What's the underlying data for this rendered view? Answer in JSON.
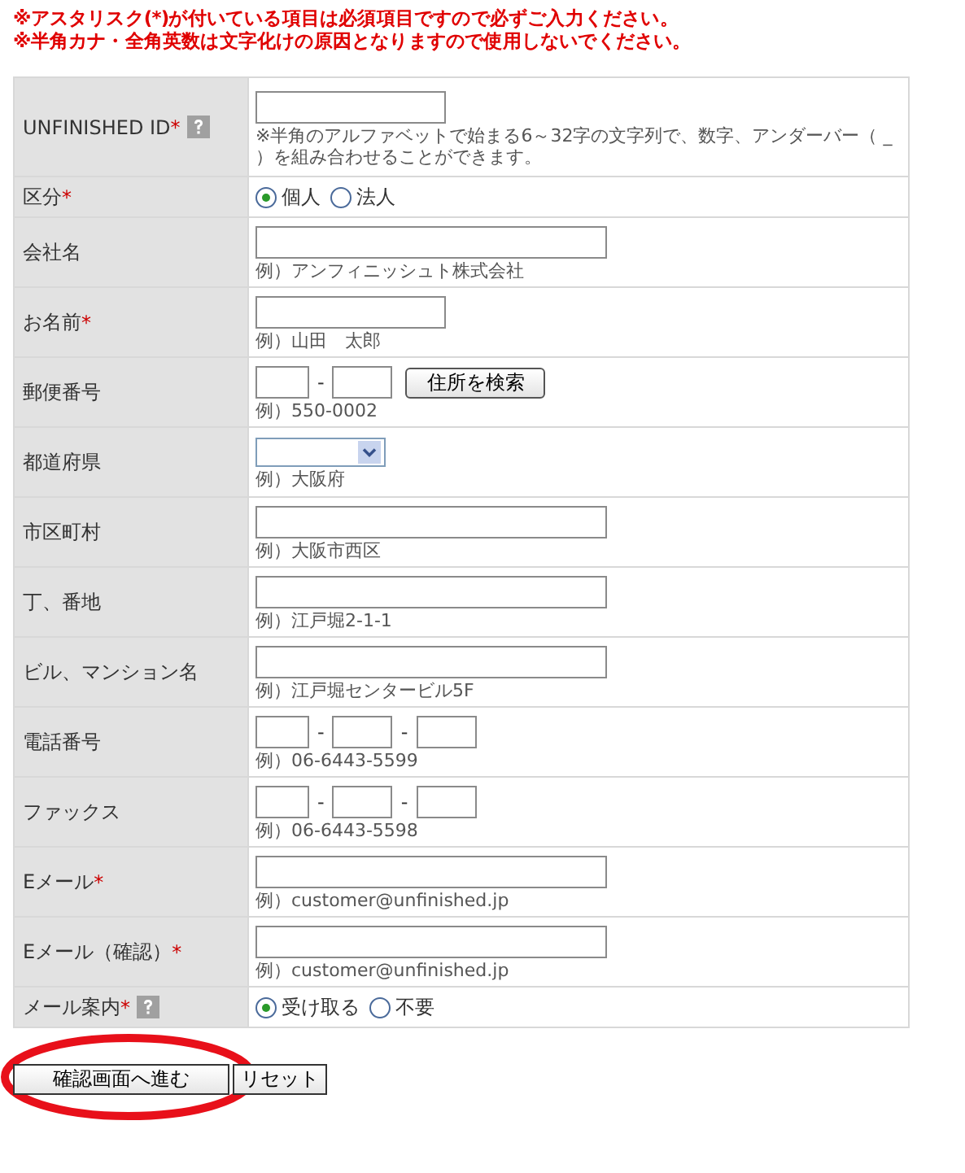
{
  "notices": [
    "※アスタリスク(*)が付いている項目は必須項目ですので必ずご入力ください。",
    "※半角カナ・全角英数は文字化けの原因となりますので使用しないでください。"
  ],
  "rows": [
    {
      "label": "UNFINISHED ID",
      "required": true,
      "help": true,
      "kind": "text",
      "hint": "※半角のアルファベットで始まる6～32字の文字列で、数字、アンダーバー（ _ ）を組み合わせることができます。"
    },
    {
      "label": "区分",
      "required": true,
      "help": false,
      "kind": "radio",
      "options": [
        {
          "label": "個人",
          "selected": true
        },
        {
          "label": "法人",
          "selected": false
        }
      ]
    },
    {
      "label": "会社名",
      "required": false,
      "help": false,
      "kind": "wide_text",
      "hint": "例）アンフィニッシュト株式会社"
    },
    {
      "label": "お名前",
      "required": true,
      "help": false,
      "kind": "text",
      "hint": "例）山田　太郎"
    },
    {
      "label": "郵便番号",
      "required": false,
      "help": false,
      "kind": "zip",
      "separator": "-",
      "button": "住所を検索",
      "hint": "例）550-0002"
    },
    {
      "label": "都道府県",
      "required": false,
      "help": false,
      "kind": "select",
      "hint": "例）大阪府"
    },
    {
      "label": "市区町村",
      "required": false,
      "help": false,
      "kind": "wide_text",
      "hint": "例）大阪市西区"
    },
    {
      "label": "丁、番地",
      "required": false,
      "help": false,
      "kind": "wide_text",
      "hint": "例）江戸堀2-1-1"
    },
    {
      "label": "ビル、マンション名",
      "required": false,
      "help": false,
      "kind": "wide_text",
      "hint": "例）江戸堀センタービル5F"
    },
    {
      "label": "電話番号",
      "required": false,
      "help": false,
      "kind": "phone",
      "separator": "-",
      "hint": "例）06-6443-5599"
    },
    {
      "label": "ファックス",
      "required": false,
      "help": false,
      "kind": "phone",
      "separator": "-",
      "hint": "例）06-6443-5598"
    },
    {
      "label": "Eメール",
      "required": true,
      "help": false,
      "kind": "wide_text",
      "hint": "例）customer@unfinished.jp"
    },
    {
      "label": "Eメール（確認）",
      "required": true,
      "help": false,
      "kind": "wide_text",
      "hint": "例）customer@unfinished.jp"
    },
    {
      "label": "メール案内",
      "required": true,
      "help": true,
      "kind": "radio",
      "options": [
        {
          "label": "受け取る",
          "selected": true
        },
        {
          "label": "不要",
          "selected": false
        }
      ]
    }
  ],
  "required_mark": "*",
  "buttons": [
    {
      "label": "確認画面へ進む",
      "circled": true
    },
    {
      "label": "リセット",
      "circled": false
    }
  ]
}
